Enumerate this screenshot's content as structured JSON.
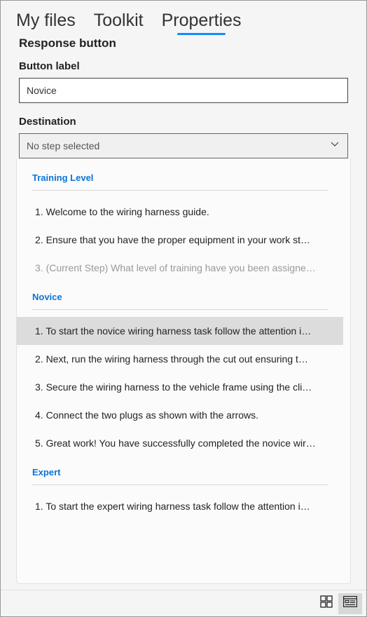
{
  "tabs": {
    "myfiles": "My files",
    "toolkit": "Toolkit",
    "properties": "Properties",
    "active": "properties"
  },
  "panel": {
    "title": "Response button",
    "button_label_field": "Button label",
    "button_label_value": "Novice",
    "destination_field": "Destination",
    "destination_value": "No step selected"
  },
  "dropdown": {
    "groups": [
      {
        "name": "Training Level",
        "items": [
          {
            "num": "1.",
            "text": "Welcome to the wiring harness guide.",
            "disabled": false,
            "hovered": false
          },
          {
            "num": "2.",
            "text": "Ensure that you have the proper equipment in your work st…",
            "disabled": false,
            "hovered": false
          },
          {
            "num": "3.",
            "text": "(Current Step) What level of training have you been assigne…",
            "disabled": true,
            "hovered": false
          }
        ]
      },
      {
        "name": "Novice",
        "items": [
          {
            "num": "1.",
            "text": "To start the novice wiring harness task follow the attention i…",
            "disabled": false,
            "hovered": true
          },
          {
            "num": "2.",
            "text": "Next, run the wiring harness through the cut out ensuring t…",
            "disabled": false,
            "hovered": false
          },
          {
            "num": "3.",
            "text": "Secure the wiring harness to the vehicle frame using the cli…",
            "disabled": false,
            "hovered": false
          },
          {
            "num": "4.",
            "text": "Connect the two plugs as shown with the arrows.",
            "disabled": false,
            "hovered": false
          },
          {
            "num": "5.",
            "text": "Great work! You have successfully completed the novice wir…",
            "disabled": false,
            "hovered": false
          }
        ]
      },
      {
        "name": "Expert",
        "items": [
          {
            "num": "1.",
            "text": "To start the expert wiring harness task follow the attention i…",
            "disabled": false,
            "hovered": false
          }
        ]
      }
    ]
  },
  "footer": {
    "grid_icon": "grid-view-icon",
    "form_icon": "form-view-icon",
    "active": "form"
  }
}
